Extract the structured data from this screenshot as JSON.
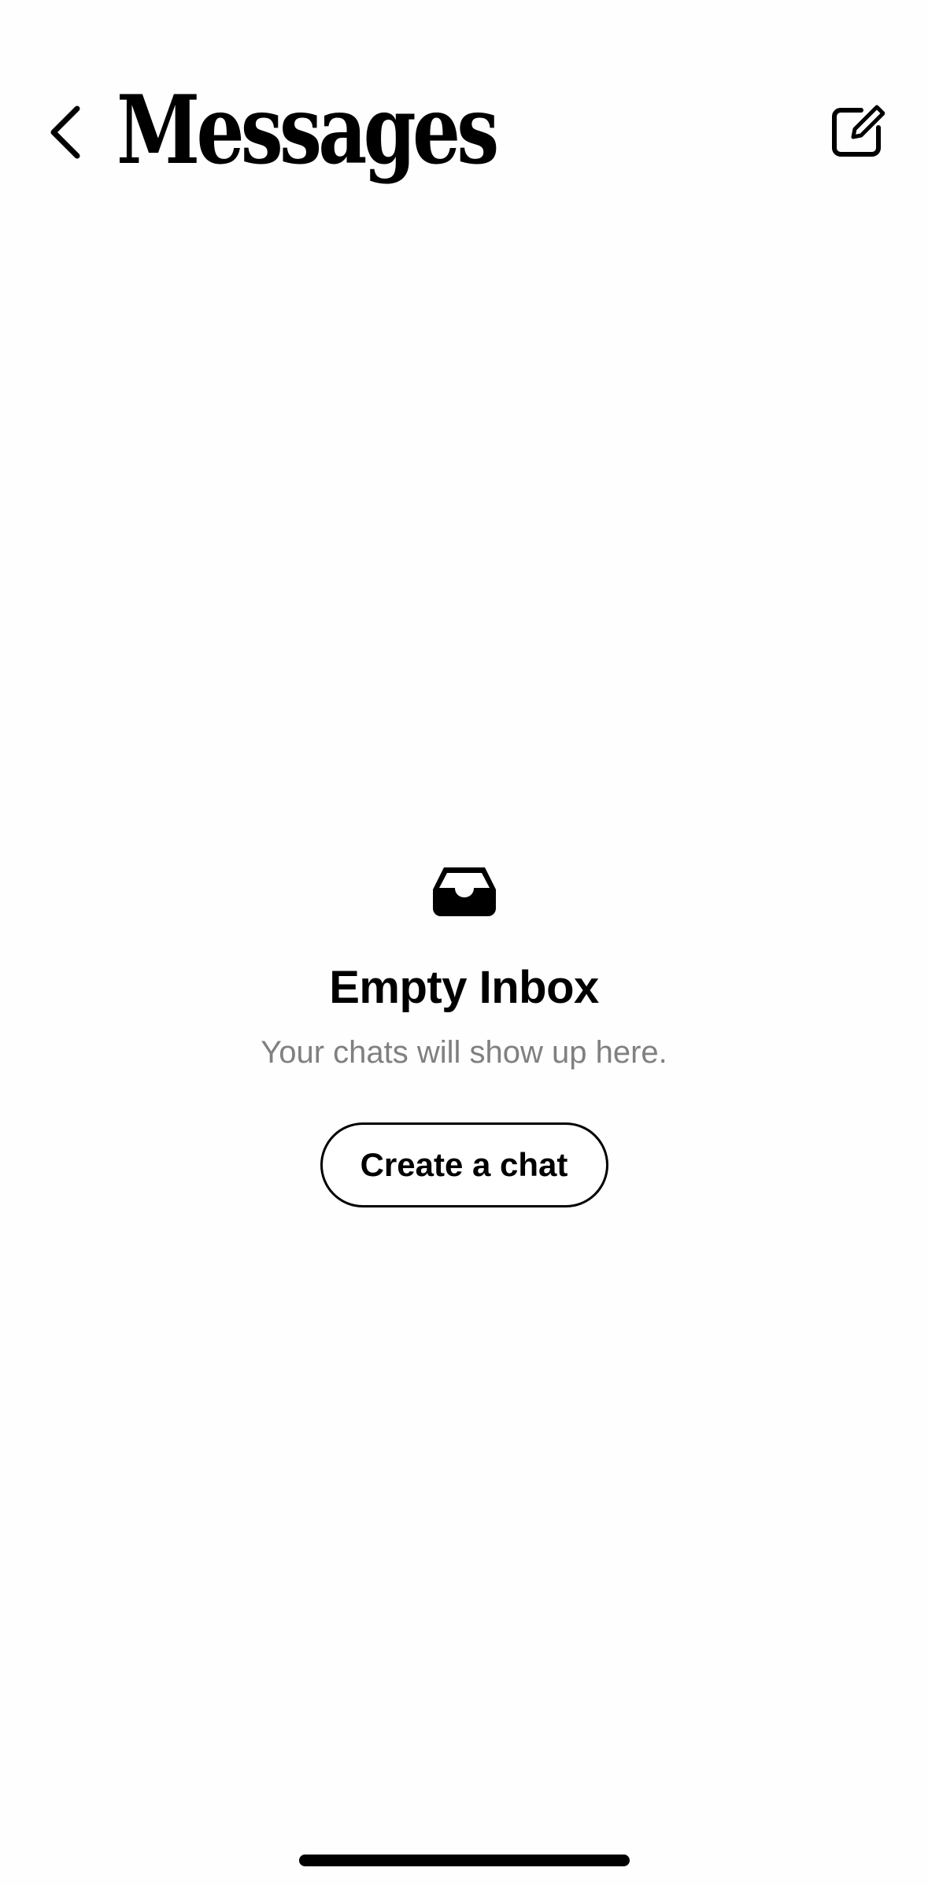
{
  "header": {
    "back_icon": "chevron-left-icon",
    "title": "Messages",
    "compose_icon": "compose-icon"
  },
  "empty_state": {
    "icon": "inbox-tray-icon",
    "title": "Empty Inbox",
    "subtitle": "Your chats will show up here.",
    "button_label": "Create a chat"
  },
  "colors": {
    "background": "#fffefe",
    "text": "#000000",
    "subtitle": "#808080"
  }
}
